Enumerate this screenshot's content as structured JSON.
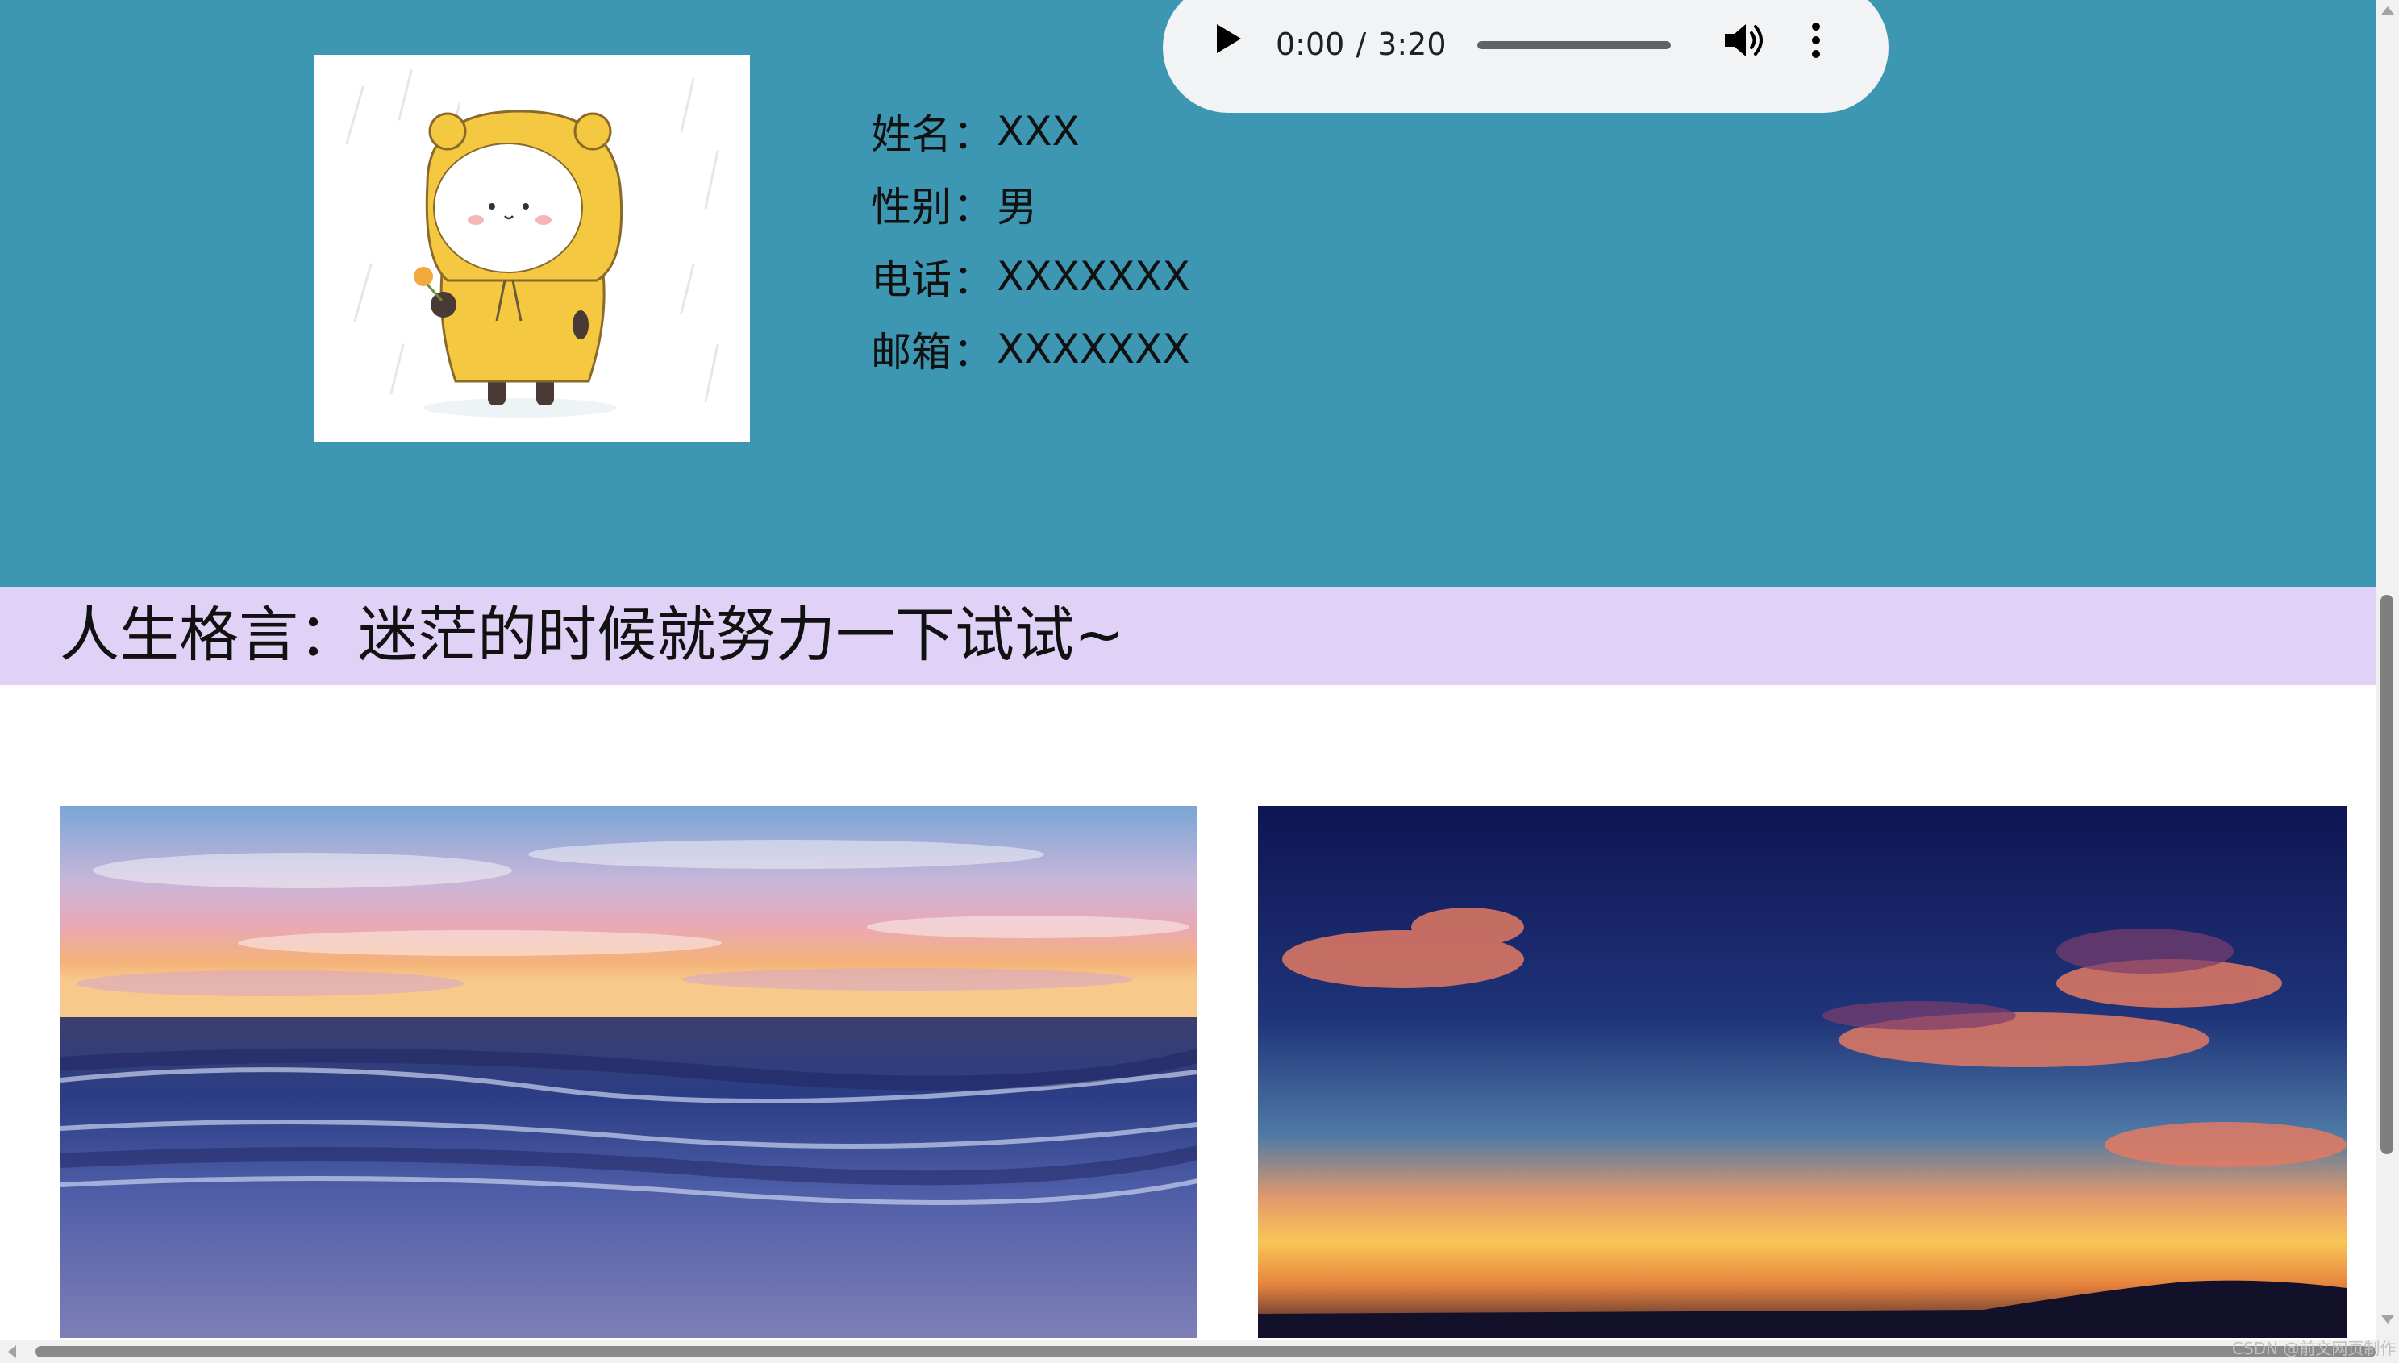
{
  "profile": {
    "rows": [
      {
        "label": "姓名",
        "value": "XXX"
      },
      {
        "label": "性别",
        "value": "男"
      },
      {
        "label": "电话",
        "value": "XXXXXXX"
      },
      {
        "label": "邮箱",
        "value": "XXXXXXX"
      }
    ],
    "colon": "："
  },
  "audio": {
    "current_time": "0:00",
    "separator": "/",
    "duration": "3:20",
    "progress": 0,
    "play_icon": "play-icon",
    "volume_icon": "volume-icon",
    "menu_icon": "more-vert-icon"
  },
  "motto": {
    "text": "人生格言：迷茫的时候就努力一下试试~"
  },
  "photos": [
    {
      "subject": "seascape-at-sunset"
    },
    {
      "subject": "sunset-sky-with-clouds"
    }
  ],
  "watermark": "CSDN @前文网页制作",
  "colors": {
    "header_bg": "#3d97b2",
    "motto_bg": "#e0d2f7",
    "audio_bg": "#f1f3f4",
    "raincoat": "#f5c842"
  }
}
